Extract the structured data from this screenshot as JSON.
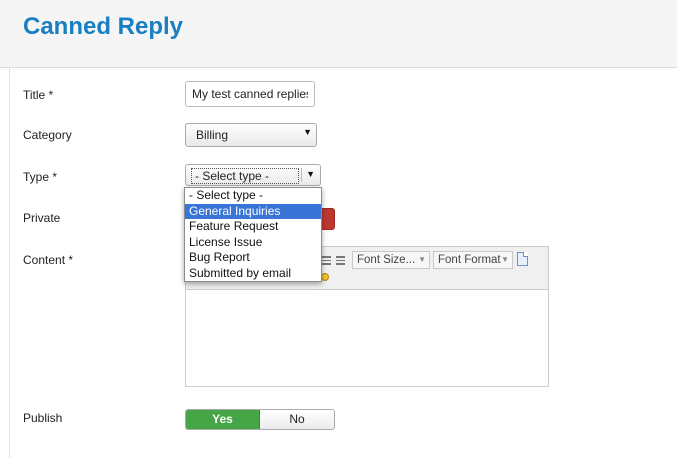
{
  "header": {
    "title": "Canned Reply"
  },
  "form": {
    "title_label": "Title *",
    "title_value": "My test canned replies",
    "category_label": "Category",
    "category_value": "Billing",
    "type_label": "Type *",
    "type_value": "- Select type -",
    "type_options": [
      "- Select type -",
      "General Inquiries",
      "Feature Request",
      "License Issue",
      "Bug Report",
      "Submitted by email"
    ],
    "type_highlighted": "General Inquiries",
    "private_label": "Private",
    "content_label": "Content *",
    "publish_label": "Publish",
    "publish_yes": "Yes",
    "publish_no": "No",
    "publish_selected": "Yes"
  },
  "editor": {
    "font_size_label": "Font Size...",
    "font_format_label": "Font Format"
  },
  "colors": {
    "title": "#1a7fc1",
    "yes_active": "#46a546",
    "private_no_active": "#bd362f",
    "dropdown_highlight": "#3875d7"
  }
}
